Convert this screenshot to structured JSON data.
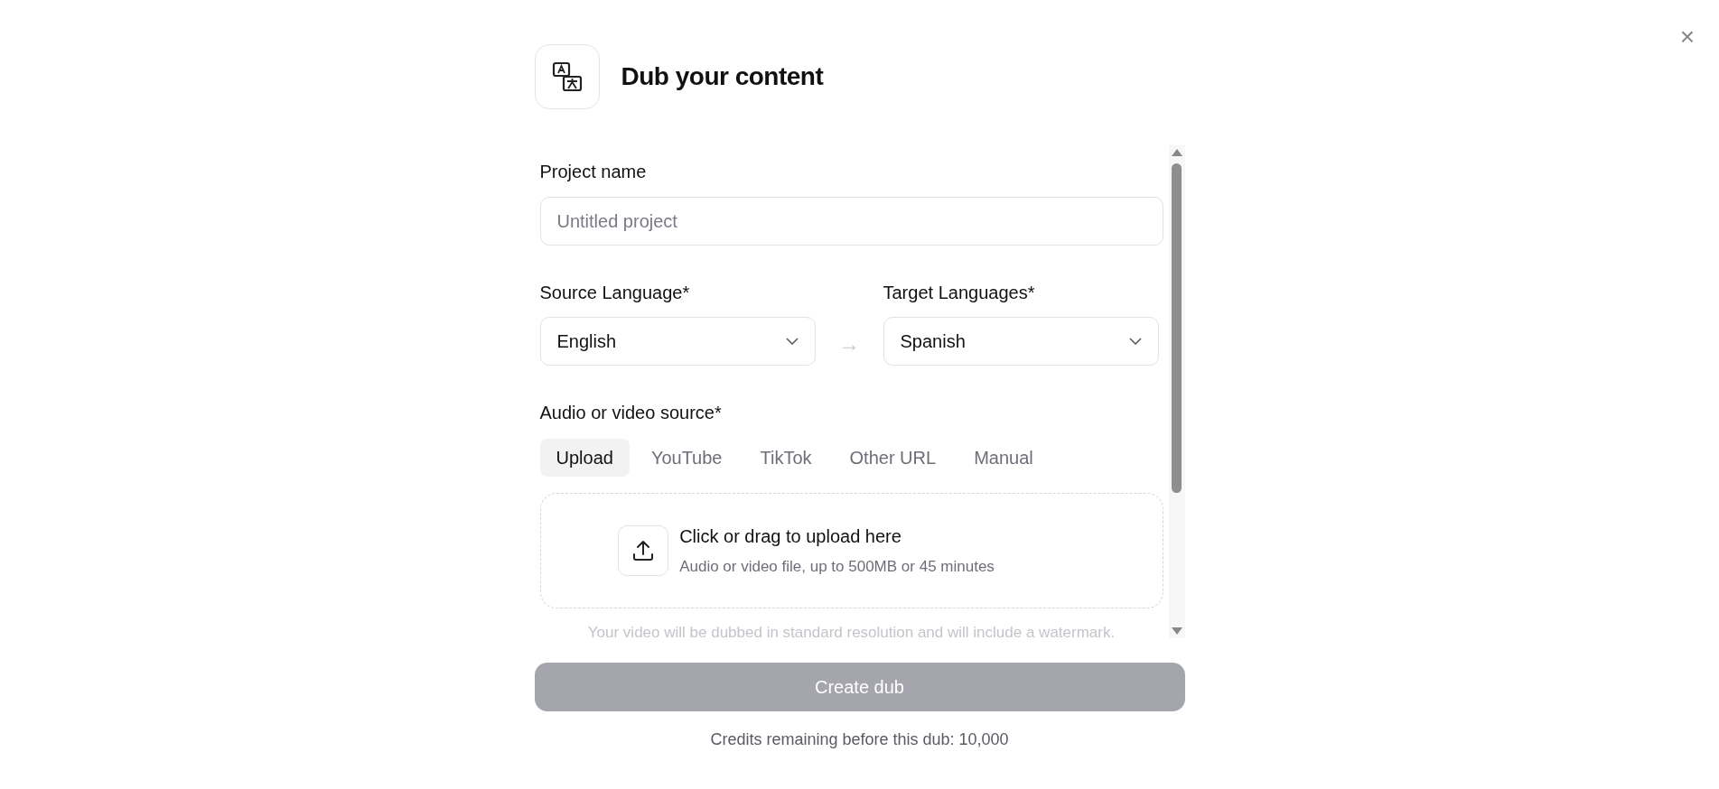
{
  "dialog": {
    "title": "Dub your content",
    "close": "×"
  },
  "project_name": {
    "label": "Project name",
    "placeholder": "Untitled project"
  },
  "source_language": {
    "label": "Source Language*",
    "value": "English"
  },
  "target_languages": {
    "label": "Target Languages*",
    "value": "Spanish"
  },
  "arrow": "→",
  "source": {
    "label": "Audio or video source*",
    "tabs": [
      {
        "label": "Upload",
        "selected": true
      },
      {
        "label": "YouTube",
        "selected": false
      },
      {
        "label": "TikTok",
        "selected": false
      },
      {
        "label": "Other URL",
        "selected": false
      },
      {
        "label": "Manual",
        "selected": false
      }
    ]
  },
  "upload": {
    "title": "Click or drag to upload here",
    "hint": "Audio or video file, up to 500MB or 45 minutes"
  },
  "notice": "Your video will be dubbed in standard resolution and will include a watermark.",
  "create_button": {
    "label": "Create dub",
    "disabled": true
  },
  "credits": "Credits remaining before this dub: 10,000"
}
